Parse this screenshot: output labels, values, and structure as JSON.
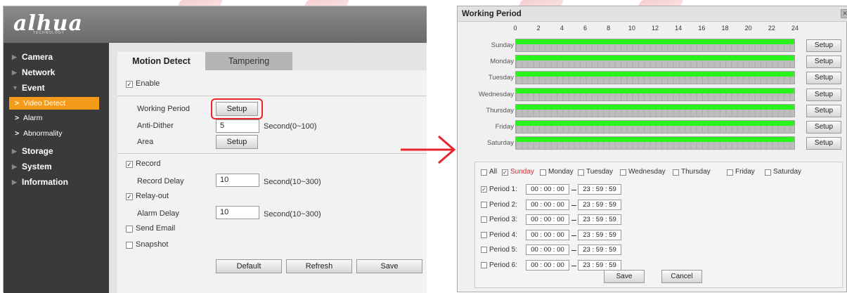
{
  "brand": {
    "logo_text": "alhua",
    "logo_sub": "TECHNOLOGY"
  },
  "sidebar": {
    "items": [
      {
        "label": "Camera",
        "type": "section"
      },
      {
        "label": "Network",
        "type": "section"
      },
      {
        "label": "Event",
        "type": "section",
        "expanded": true
      },
      {
        "label": "Video Detect",
        "type": "sub",
        "active": true
      },
      {
        "label": "Alarm",
        "type": "sub"
      },
      {
        "label": "Abnormality",
        "type": "sub"
      },
      {
        "label": "Storage",
        "type": "section"
      },
      {
        "label": "System",
        "type": "section"
      },
      {
        "label": "Information",
        "type": "section"
      }
    ],
    "active_color": "#f49b1a"
  },
  "tabs": [
    {
      "label": "Motion Detect",
      "active": true
    },
    {
      "label": "Tampering",
      "active": false
    }
  ],
  "form": {
    "enable_label": "Enable",
    "enable_checked": true,
    "working_period_label": "Working Period",
    "working_period_button": "Setup",
    "anti_dither_label": "Anti-Dither",
    "anti_dither_value": "5",
    "anti_dither_unit": "Second(0~100)",
    "area_label": "Area",
    "area_button": "Setup",
    "record_label": "Record",
    "record_checked": true,
    "record_delay_label": "Record Delay",
    "record_delay_value": "10",
    "record_delay_unit": "Second(10~300)",
    "relay_out_label": "Relay-out",
    "relay_out_checked": true,
    "alarm_delay_label": "Alarm Delay",
    "alarm_delay_value": "10",
    "alarm_delay_unit": "Second(10~300)",
    "send_email_label": "Send Email",
    "send_email_checked": false,
    "snapshot_label": "Snapshot",
    "snapshot_checked": false,
    "default_button": "Default",
    "refresh_button": "Refresh",
    "save_button": "Save"
  },
  "highlight_color": "#e8242c",
  "dialog": {
    "title": "Working Period",
    "hours": [
      "0",
      "2",
      "4",
      "6",
      "8",
      "10",
      "12",
      "14",
      "16",
      "18",
      "20",
      "22",
      "24"
    ],
    "days": [
      {
        "name": "Sunday",
        "setup": "Setup"
      },
      {
        "name": "Monday",
        "setup": "Setup"
      },
      {
        "name": "Tuesday",
        "setup": "Setup"
      },
      {
        "name": "Wednesday",
        "setup": "Setup"
      },
      {
        "name": "Thursday",
        "setup": "Setup"
      },
      {
        "name": "Friday",
        "setup": "Setup"
      },
      {
        "name": "Saturday",
        "setup": "Setup"
      }
    ],
    "schedule_fill_color": "#2af31b",
    "day_checks": [
      {
        "label": "All",
        "checked": false
      },
      {
        "label": "Sunday",
        "checked": true,
        "current": true
      },
      {
        "label": "Monday",
        "checked": false
      },
      {
        "label": "Tuesday",
        "checked": false
      },
      {
        "label": "Wednesday",
        "checked": false
      },
      {
        "label": "Thursday",
        "checked": false
      },
      {
        "label": "Friday",
        "checked": false
      },
      {
        "label": "Saturday",
        "checked": false
      }
    ],
    "periods": [
      {
        "label": "Period 1:",
        "checked": true,
        "start": "00 : 00 : 00",
        "end": "23 : 59 : 59"
      },
      {
        "label": "Period 2:",
        "checked": false,
        "start": "00 : 00 : 00",
        "end": "23 : 59 : 59"
      },
      {
        "label": "Period 3:",
        "checked": false,
        "start": "00 : 00 : 00",
        "end": "23 : 59 : 59"
      },
      {
        "label": "Period 4:",
        "checked": false,
        "start": "00 : 00 : 00",
        "end": "23 : 59 : 59"
      },
      {
        "label": "Period 5:",
        "checked": false,
        "start": "00 : 00 : 00",
        "end": "23 : 59 : 59"
      },
      {
        "label": "Period 6:",
        "checked": false,
        "start": "00 : 00 : 00",
        "end": "23 : 59 : 59"
      }
    ],
    "save_button": "Save",
    "cancel_button": "Cancel"
  }
}
